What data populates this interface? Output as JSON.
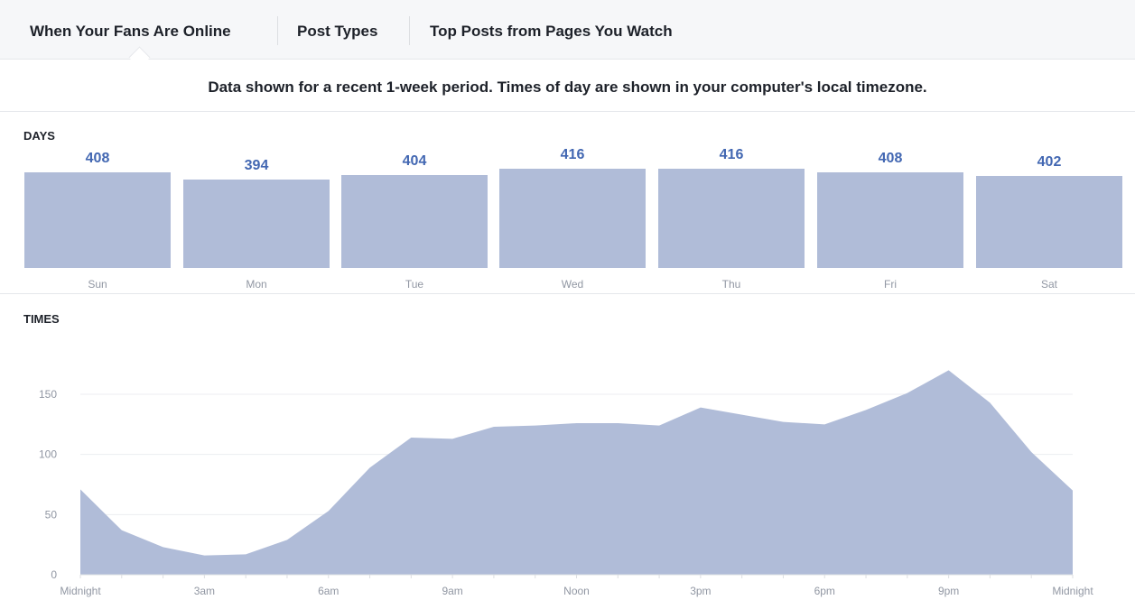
{
  "tabs": [
    {
      "label": "When Your Fans Are Online",
      "active": true
    },
    {
      "label": "Post Types",
      "active": false
    },
    {
      "label": "Top Posts from Pages You Watch",
      "active": false
    }
  ],
  "notice": "Data shown for a recent 1-week period. Times of day are shown in your computer's local timezone.",
  "days_section": {
    "label": "DAYS"
  },
  "times_section": {
    "label": "TIMES"
  },
  "colors": {
    "bar_fill": "#b0bcd8",
    "value_text": "#4267b2"
  },
  "chart_data": [
    {
      "type": "bar",
      "title": "DAYS",
      "categories": [
        "Sun",
        "Mon",
        "Tue",
        "Wed",
        "Thu",
        "Fri",
        "Sat"
      ],
      "values": [
        408,
        394,
        404,
        416,
        416,
        408,
        402
      ]
    },
    {
      "type": "area",
      "title": "TIMES",
      "x": [
        0,
        1,
        2,
        3,
        4,
        5,
        6,
        7,
        8,
        9,
        10,
        11,
        12,
        13,
        14,
        15,
        16,
        17,
        18,
        19,
        20,
        21,
        22,
        23,
        24
      ],
      "values": [
        71,
        37,
        23,
        16,
        17,
        29,
        53,
        89,
        114,
        113,
        123,
        124,
        126,
        126,
        124,
        139,
        133,
        127,
        125,
        137,
        151,
        170,
        143,
        102,
        70
      ],
      "xticks": [
        {
          "x": 0,
          "label": "Midnight"
        },
        {
          "x": 3,
          "label": "3am"
        },
        {
          "x": 6,
          "label": "6am"
        },
        {
          "x": 9,
          "label": "9am"
        },
        {
          "x": 12,
          "label": "Noon"
        },
        {
          "x": 15,
          "label": "3pm"
        },
        {
          "x": 18,
          "label": "6pm"
        },
        {
          "x": 21,
          "label": "9pm"
        },
        {
          "x": 24,
          "label": "Midnight"
        }
      ],
      "yticks": [
        0,
        50,
        100,
        150
      ],
      "ylim": [
        0,
        180
      ],
      "grid": true
    }
  ]
}
